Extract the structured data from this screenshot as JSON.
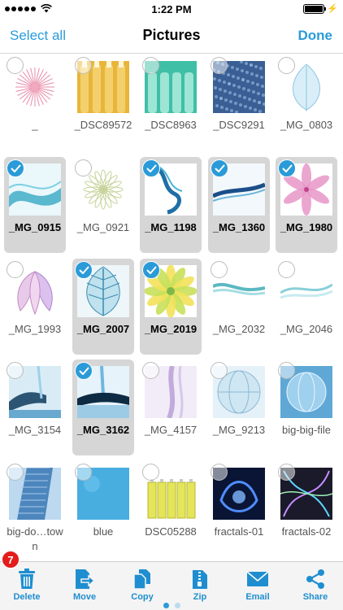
{
  "status_bar": {
    "time": "1:22 PM"
  },
  "nav": {
    "left": "Select all",
    "title": "Pictures",
    "right": "Done"
  },
  "grid": [
    {
      "name": "_",
      "selected": false,
      "thumb": "starburst-pink"
    },
    {
      "name": "_DSC89572",
      "selected": false,
      "thumb": "bottles-yellow"
    },
    {
      "name": "_DSC8963",
      "selected": false,
      "thumb": "bottles-green"
    },
    {
      "name": "_DSC9291",
      "selected": false,
      "thumb": "texture-blue"
    },
    {
      "name": "_MG_0803",
      "selected": false,
      "thumb": "leaf-blue"
    },
    {
      "name": "_MG_0915",
      "selected": true,
      "thumb": "wave-teal"
    },
    {
      "name": "_MG_0921",
      "selected": false,
      "thumb": "flower-lines"
    },
    {
      "name": "_MG_1198",
      "selected": true,
      "thumb": "smoke-blue"
    },
    {
      "name": "_MG_1360",
      "selected": true,
      "thumb": "wave-dark"
    },
    {
      "name": "_MG_1980",
      "selected": true,
      "thumb": "flower-pink"
    },
    {
      "name": "_MG_1993",
      "selected": false,
      "thumb": "leaves-purple"
    },
    {
      "name": "_MG_2007",
      "selected": true,
      "thumb": "leaf-blue-big"
    },
    {
      "name": "_MG_2019",
      "selected": true,
      "thumb": "flower-yellow"
    },
    {
      "name": "_MG_2032",
      "selected": false,
      "thumb": "smoke-teal"
    },
    {
      "name": "_MG_2046",
      "selected": false,
      "thumb": "smoke-light"
    },
    {
      "name": "_MG_3154",
      "selected": false,
      "thumb": "water-hand"
    },
    {
      "name": "_MG_3162",
      "selected": true,
      "thumb": "water-splash"
    },
    {
      "name": "_MG_4157",
      "selected": false,
      "thumb": "water-purple"
    },
    {
      "name": "_MG_9213",
      "selected": false,
      "thumb": "globe"
    },
    {
      "name": "big-big-file",
      "selected": false,
      "thumb": "globe-blue"
    },
    {
      "name": "big-do…town",
      "selected": false,
      "thumb": "building"
    },
    {
      "name": "blue",
      "selected": false,
      "thumb": "blue-plain"
    },
    {
      "name": "DSC05288",
      "selected": false,
      "thumb": "batteries"
    },
    {
      "name": "fractals-01",
      "selected": false,
      "thumb": "fractal-blue"
    },
    {
      "name": "fractals-02",
      "selected": false,
      "thumb": "fractal-multi"
    }
  ],
  "toolbar": {
    "badge": "7",
    "items": [
      {
        "label": "Delete",
        "icon": "trash-icon"
      },
      {
        "label": "Move",
        "icon": "move-icon"
      },
      {
        "label": "Copy",
        "icon": "copy-icon"
      },
      {
        "label": "Zip",
        "icon": "zip-icon"
      },
      {
        "label": "Email",
        "icon": "email-icon"
      },
      {
        "label": "Share",
        "icon": "share-icon"
      }
    ]
  },
  "pager": {
    "count": 2,
    "current": 0
  },
  "colors": {
    "accent": "#2a9bd8",
    "selected_bg": "#d6d6d6",
    "badge": "#e31c1c"
  }
}
